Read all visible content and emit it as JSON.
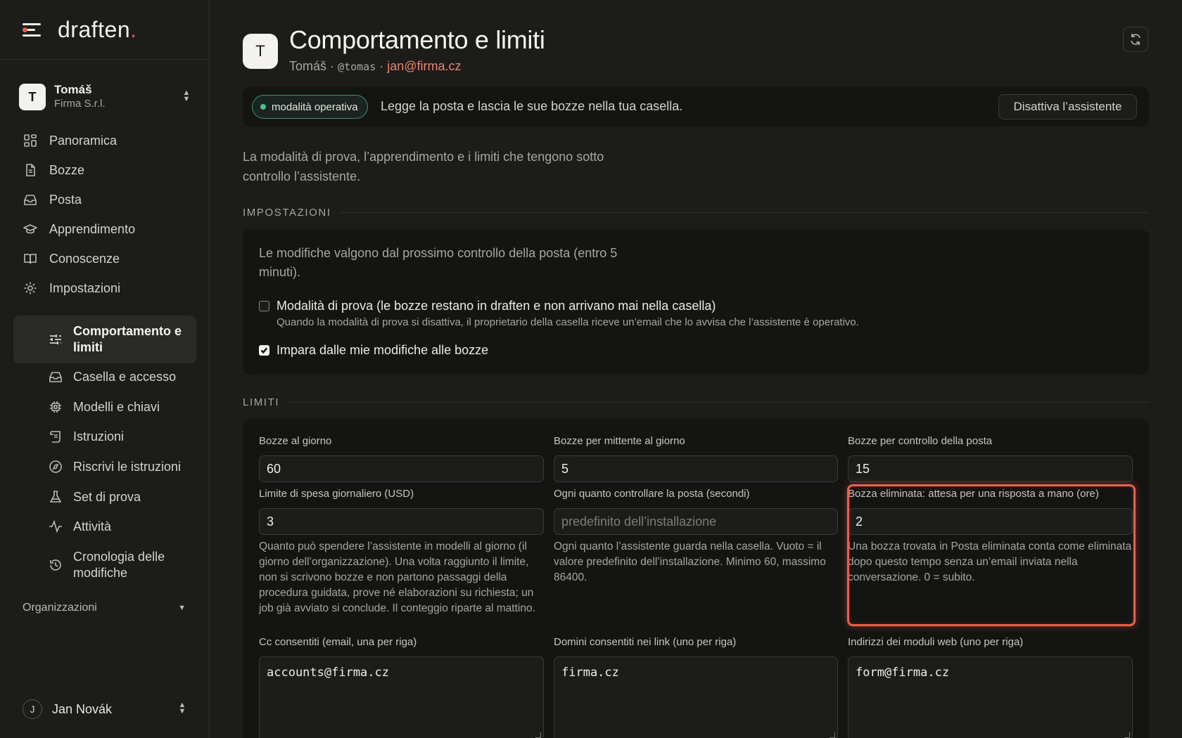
{
  "brand": {
    "name": "draften",
    "dot": "."
  },
  "account": {
    "initial": "T",
    "name": "Tomáš",
    "org": "Firma S.r.l."
  },
  "nav": {
    "items": [
      {
        "label": "Panoramica",
        "icon": "grid-icon"
      },
      {
        "label": "Bozze",
        "icon": "document-icon"
      },
      {
        "label": "Posta",
        "icon": "inbox-icon"
      },
      {
        "label": "Apprendimento",
        "icon": "graduation-cap-icon"
      },
      {
        "label": "Conoscenze",
        "icon": "book-icon"
      },
      {
        "label": "Impostazioni",
        "icon": "gear-icon"
      }
    ],
    "settings_sub": [
      {
        "label": "Comportamento e limiti",
        "icon": "sliders-icon",
        "active": true
      },
      {
        "label": "Casella e accesso",
        "icon": "inbox-icon"
      },
      {
        "label": "Modelli e chiavi",
        "icon": "chip-icon"
      },
      {
        "label": "Istruzioni",
        "icon": "scroll-icon"
      },
      {
        "label": "Riscrivi le istruzioni",
        "icon": "compass-icon"
      },
      {
        "label": "Set di prova",
        "icon": "flask-icon"
      },
      {
        "label": "Attività",
        "icon": "activity-icon"
      },
      {
        "label": "Cronologia delle modifiche",
        "icon": "history-icon"
      }
    ],
    "orgs_label": "Organizzazioni"
  },
  "user": {
    "initial": "J",
    "name": "Jan Novák"
  },
  "header": {
    "initial": "T",
    "title": "Comportamento e limiti",
    "name": "Tomáš",
    "sep": "·",
    "handle": "@tomas",
    "email": "jan@firma.cz"
  },
  "status": {
    "badge": "modalità operativa",
    "text": "Legge la posta e lascia le sue bozze nella tua casella.",
    "deactivate": "Disattiva l’assistente"
  },
  "intro": "La modalità di prova, l’apprendimento e i limiti che tengono sotto controllo l’assistente.",
  "settings": {
    "heading": "IMPOSTAZIONI",
    "note": "Le modifiche valgono dal prossimo controllo della posta (entro 5 minuti).",
    "trial_label": "Modalità di prova (le bozze restano in draften e non arrivano mai nella casella)",
    "trial_checked": false,
    "trial_help": "Quando la modalità di prova si disattiva, il proprietario della casella riceve un’email che lo avvisa che l’assistente è operativo.",
    "learn_label": "Impara dalle mie modifiche alle bozze",
    "learn_checked": true
  },
  "limits": {
    "heading": "LIMITI",
    "drafts_day": {
      "label": "Bozze al giorno",
      "value": "60"
    },
    "drafts_sender": {
      "label": "Bozze per mittente al giorno",
      "value": "5"
    },
    "drafts_check": {
      "label": "Bozze per controllo della posta",
      "value": "15"
    },
    "spend": {
      "label": "Limite di spesa giornaliero (USD)",
      "value": "3",
      "help": "Quanto può spendere l’assistente in modelli al giorno (il giorno dell’organizzazione). Una volta raggiunto il limite, non si scrivono bozze e non partono passaggi della procedura guidata, prove né elaborazioni su richiesta; un job già avviato si conclude. Il conteggio riparte al mattino."
    },
    "interval": {
      "label": "Ogni quanto controllare la posta (secondi)",
      "placeholder": "predefinito dell’installazione",
      "help": "Ogni quanto l’assistente guarda nella casella. Vuoto = il valore predefinito dell’installazione. Minimo 60, massimo 86400."
    },
    "deleted_wait": {
      "label": "Bozza eliminata: attesa per una risposta a mano (ore)",
      "value": "2",
      "help": "Una bozza trovata in Posta eliminata conta come eliminata dopo questo tempo senza un’email inviata nella conversazione. 0 = subito."
    },
    "cc": {
      "label": "Cc consentiti (email, una per riga)",
      "value": "accounts@firma.cz"
    },
    "domains": {
      "label": "Domini consentiti nei link (uno per riga)",
      "value": "firma.cz"
    },
    "webforms": {
      "label": "Indirizzi dei moduli web (uno per riga)",
      "value": "form@firma.cz"
    }
  },
  "colors": {
    "accent": "#e8604a",
    "status_green": "#4cc08a",
    "background": "#1c1c1b",
    "card": "#141413"
  }
}
